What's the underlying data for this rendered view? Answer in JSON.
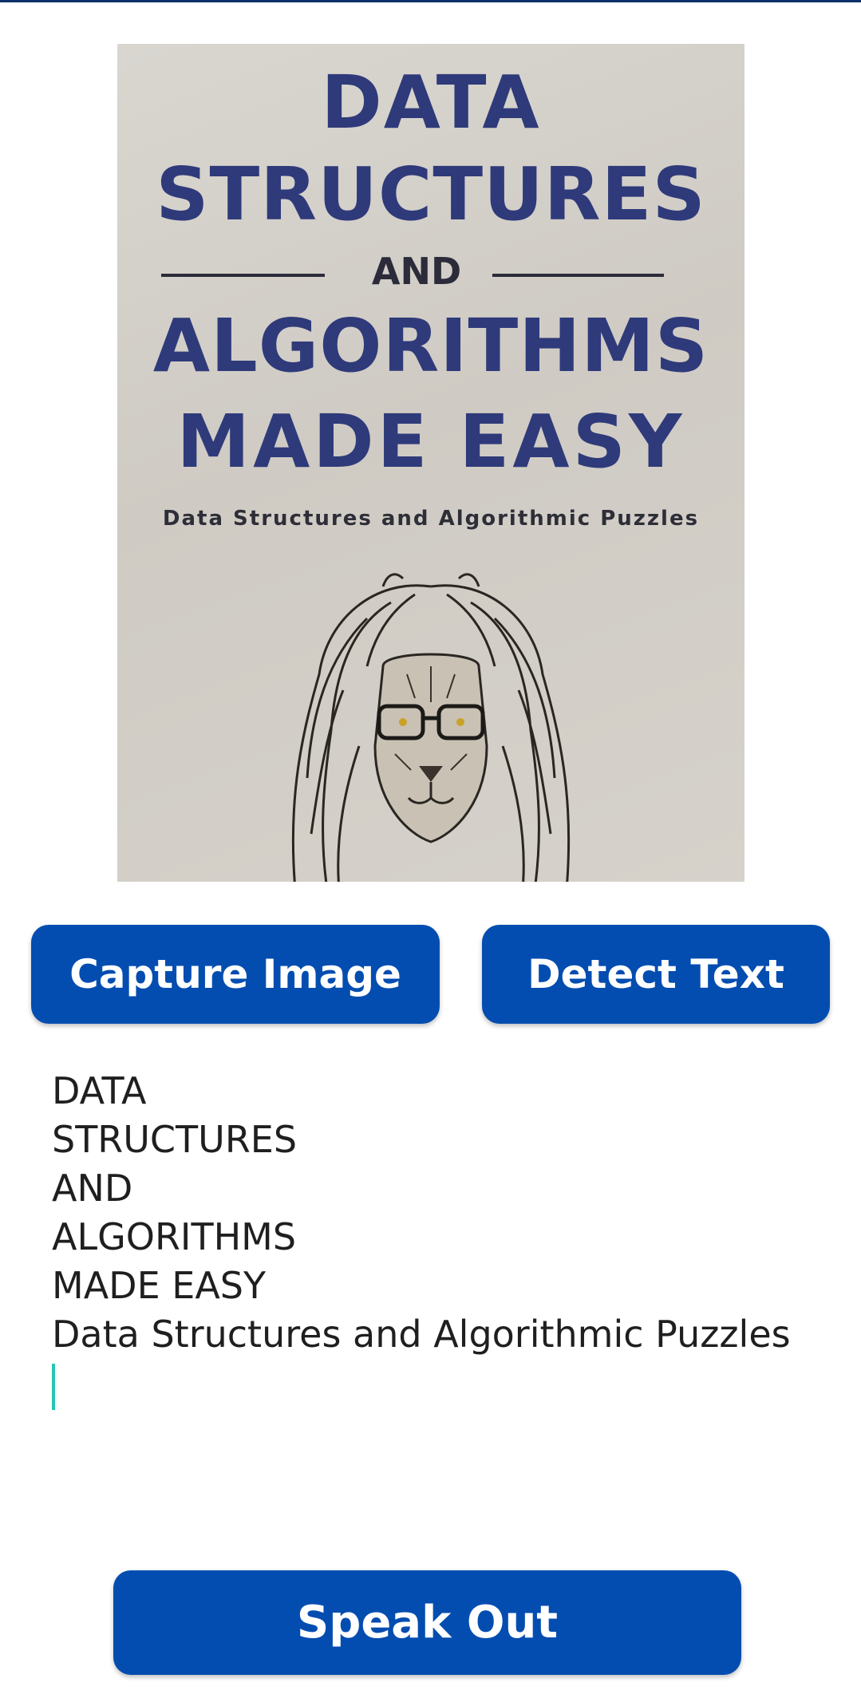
{
  "cover_image": {
    "line1": "DATA",
    "line2": "STRUCTURES",
    "line3": "AND",
    "line4": "ALGORITHMS",
    "line5": "MADE EASY",
    "subtitle": "Data Structures and Algorithmic Puzzles"
  },
  "buttons": {
    "capture": "Capture Image",
    "detect": "Detect Text",
    "speak": "Speak Out"
  },
  "detected_text": {
    "lines": [
      "DATA",
      "STRUCTURES",
      "AND",
      "ALGORITHMS",
      "MADE EASY",
      "Data Structures and Algorithmic Puzzles"
    ]
  },
  "colors": {
    "button": "#044db0",
    "cover_title": "#2f3a7a",
    "caret": "#26c6b3",
    "top_bar": "#0d2f6a"
  }
}
